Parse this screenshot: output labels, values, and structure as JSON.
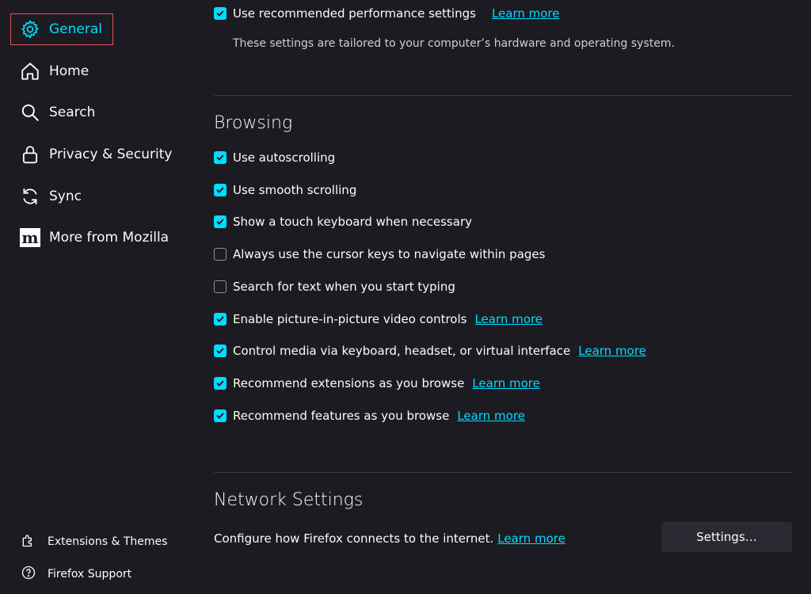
{
  "sidebar": {
    "items": [
      {
        "label": "General",
        "icon": "gear-icon",
        "selected": true
      },
      {
        "label": "Home",
        "icon": "home-icon"
      },
      {
        "label": "Search",
        "icon": "search-icon"
      },
      {
        "label": "Privacy & Security",
        "icon": "lock-icon"
      },
      {
        "label": "Sync",
        "icon": "sync-icon"
      },
      {
        "label": "More from Mozilla",
        "icon": "mozilla-logo-icon"
      }
    ],
    "footer": [
      {
        "label": "Extensions & Themes",
        "icon": "puzzle-piece-icon"
      },
      {
        "label": "Firefox Support",
        "icon": "help-icon"
      }
    ]
  },
  "performance": {
    "checkbox_label": "Use recommended performance settings",
    "learn_more": "Learn more",
    "description": "These settings are tailored to your computer’s hardware and operating system."
  },
  "browsing": {
    "title": "Browsing",
    "options": [
      {
        "label": "Use autoscrolling",
        "checked": true
      },
      {
        "label": "Use smooth scrolling",
        "checked": true
      },
      {
        "label": "Show a touch keyboard when necessary",
        "checked": true
      },
      {
        "label": "Always use the cursor keys to navigate within pages",
        "checked": false
      },
      {
        "label": "Search for text when you start typing",
        "checked": false
      },
      {
        "label": "Enable picture-in-picture video controls",
        "checked": true,
        "link": "Learn more"
      },
      {
        "label": "Control media via keyboard, headset, or virtual interface",
        "checked": true,
        "link": "Learn more"
      },
      {
        "label": "Recommend extensions as you browse",
        "checked": true,
        "link": "Learn more"
      },
      {
        "label": "Recommend features as you browse",
        "checked": true,
        "link": "Learn more"
      }
    ]
  },
  "network": {
    "title": "Network Settings",
    "description": "Configure how Firefox connects to the internet.",
    "learn_more": "Learn more",
    "button_label": "Settings…"
  },
  "colors": {
    "background": "#1c1b22",
    "accent": "#00ddff",
    "selection_outline": "#e0535d",
    "button_bg": "#2b2a33"
  }
}
